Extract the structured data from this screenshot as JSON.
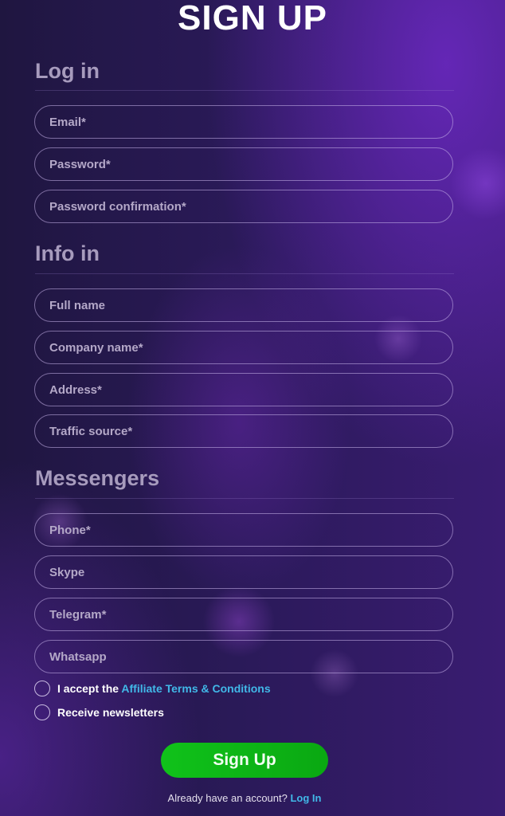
{
  "page_title": "SIGN UP",
  "sections": {
    "login": {
      "title": "Log in",
      "fields": [
        {
          "placeholder": "Email*"
        },
        {
          "placeholder": "Password*"
        },
        {
          "placeholder": "Password confirmation*"
        }
      ]
    },
    "info": {
      "title": "Info in",
      "fields": [
        {
          "placeholder": "Full name"
        },
        {
          "placeholder": "Company name*"
        },
        {
          "placeholder": "Address*"
        },
        {
          "placeholder": "Traffic source*"
        }
      ]
    },
    "messengers": {
      "title": "Messengers",
      "fields": [
        {
          "placeholder": "Phone*"
        },
        {
          "placeholder": "Skype"
        },
        {
          "placeholder": "Telegram*"
        },
        {
          "placeholder": "Whatsapp"
        }
      ]
    }
  },
  "terms": {
    "prefix": "I accept the ",
    "link": "Affiliate Terms & Conditions",
    "checked": false
  },
  "newsletter": {
    "label": "Receive newsletters",
    "checked": false
  },
  "submit_label": "Sign Up",
  "footer": {
    "text": "Already have an account? ",
    "link": "Log In"
  },
  "colors": {
    "accent_link": "#41b8e8",
    "button_green": "#10c21a",
    "background": "#2b1a5a"
  }
}
